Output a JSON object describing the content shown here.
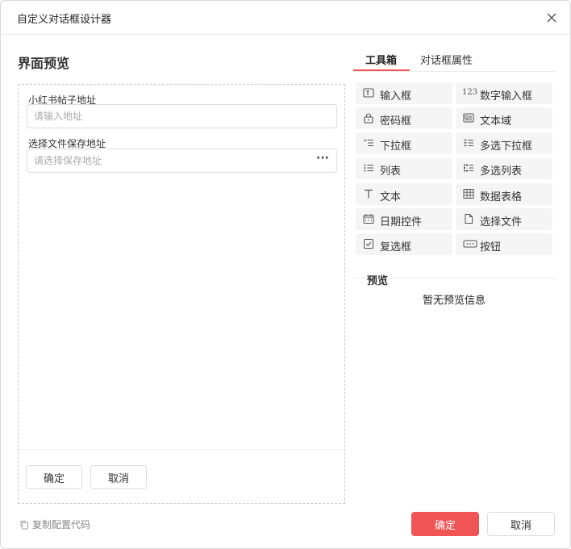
{
  "dialog": {
    "title": "自定义对话框设计器"
  },
  "preview": {
    "heading": "界面预览",
    "fields": [
      {
        "label": "小红书帖子地址",
        "placeholder": "请输入地址"
      },
      {
        "label": "选择文件保存地址",
        "placeholder": "请选择保存地址",
        "action": "···"
      }
    ],
    "confirm_label": "确定",
    "cancel_label": "取消"
  },
  "tabs": [
    {
      "label": "工具箱",
      "active": true
    },
    {
      "label": "对话框属性",
      "active": false
    }
  ],
  "toolbox": [
    {
      "label": "输入框",
      "icon": "input-box-icon"
    },
    {
      "label": "数字输入框",
      "icon": "number-123-icon"
    },
    {
      "label": "密码框",
      "icon": "lock-icon"
    },
    {
      "label": "文本域",
      "icon": "textarea-icon"
    },
    {
      "label": "下拉框",
      "icon": "dropdown-list-icon"
    },
    {
      "label": "多选下拉框",
      "icon": "multi-dropdown-icon"
    },
    {
      "label": "列表",
      "icon": "list-icon"
    },
    {
      "label": "多选列表",
      "icon": "multi-list-icon"
    },
    {
      "label": "文本",
      "icon": "text-t-icon"
    },
    {
      "label": "数据表格",
      "icon": "table-grid-icon"
    },
    {
      "label": "日期控件",
      "icon": "calendar-icon"
    },
    {
      "label": "选择文件",
      "icon": "file-icon"
    },
    {
      "label": "复选框",
      "icon": "checkbox-icon"
    },
    {
      "label": "按钮",
      "icon": "button-icon"
    }
  ],
  "preview_panel": {
    "title": "预览",
    "empty_text": "暂无预览信息"
  },
  "footer": {
    "copy_label": "复制配置代码",
    "ok_label": "确定",
    "cancel_label": "取消"
  },
  "colors": {
    "accent": "#f05454",
    "tool_bg": "#f5f5f5",
    "border": "#dcdcdc"
  },
  "icons": {
    "number_icon_text": "123"
  }
}
